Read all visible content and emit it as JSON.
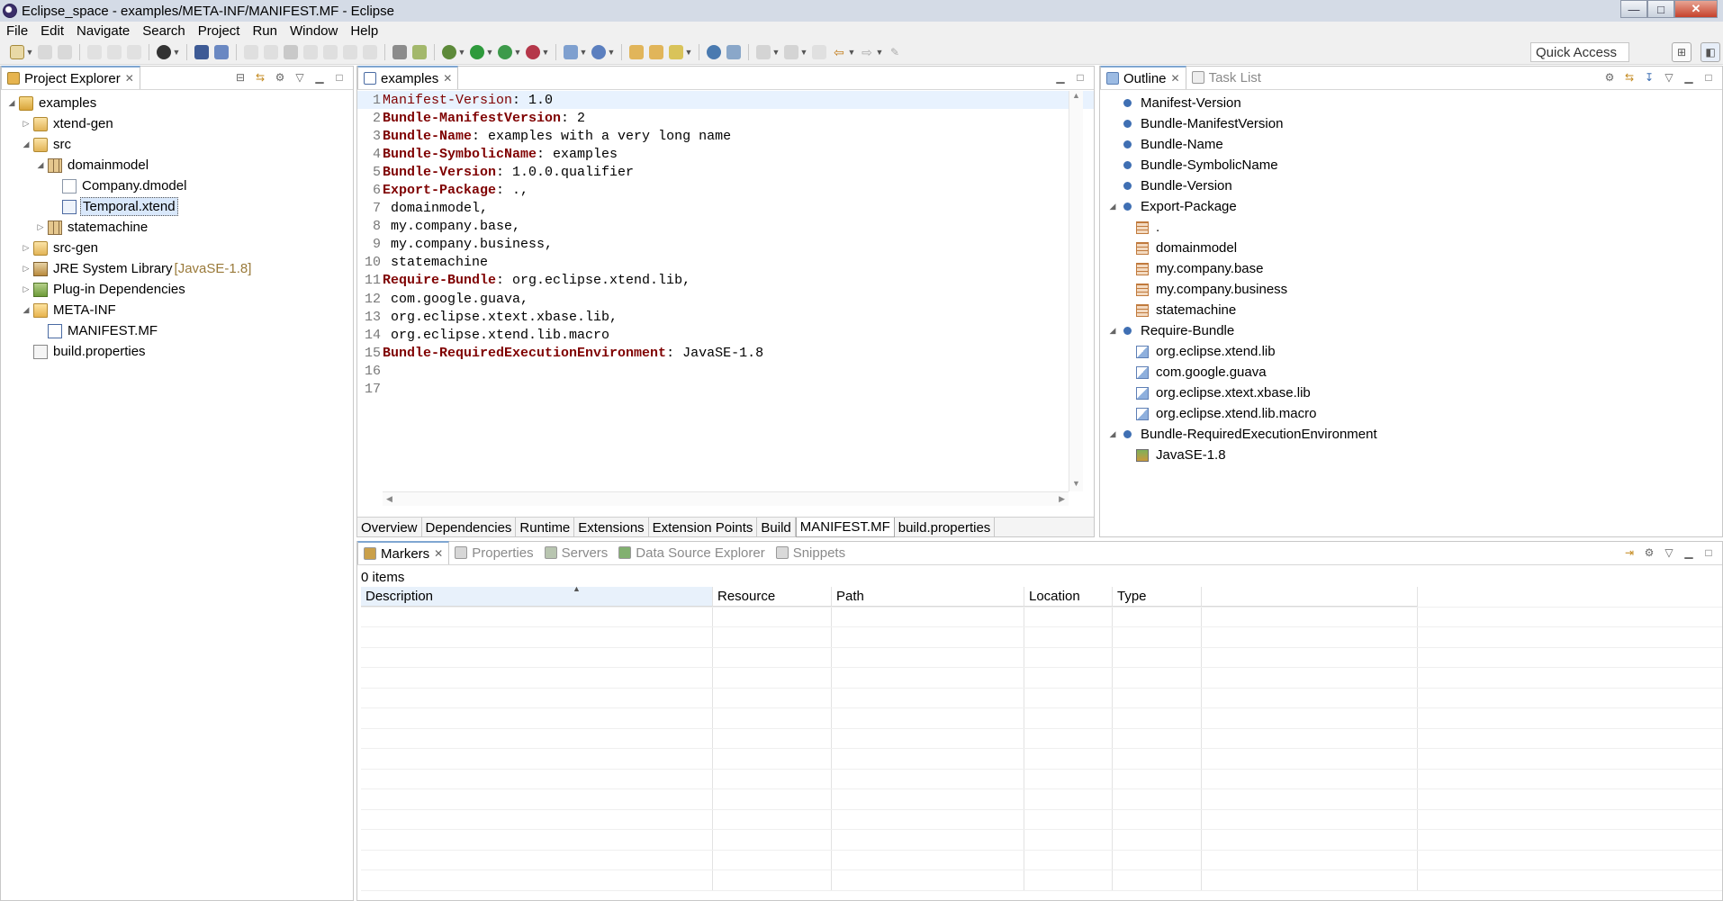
{
  "window": {
    "title": "Eclipse_space - examples/META-INF/MANIFEST.MF - Eclipse",
    "buttons": {
      "minimize": "—",
      "maximize": "□",
      "close": "✕"
    }
  },
  "menu": [
    "File",
    "Edit",
    "Navigate",
    "Search",
    "Project",
    "Run",
    "Window",
    "Help"
  ],
  "toolbar": {
    "quick_access": "Quick Access"
  },
  "project_explorer": {
    "tab_label": "Project Explorer",
    "tree": [
      {
        "label": "examples",
        "icon": "project-icon",
        "twisty": "expanded",
        "level": 0
      },
      {
        "label": "xtend-gen",
        "icon": "source-folder-icon",
        "twisty": "collapsed",
        "level": 1
      },
      {
        "label": "src",
        "icon": "source-folder-icon",
        "twisty": "expanded",
        "level": 1
      },
      {
        "label": "domainmodel",
        "icon": "package-icon",
        "twisty": "expanded",
        "level": 2
      },
      {
        "label": "Company.dmodel",
        "icon": "file-icon",
        "twisty": "none",
        "level": 3
      },
      {
        "label": "Temporal.xtend",
        "icon": "xtend-file-icon",
        "twisty": "none",
        "level": 3,
        "selected": true
      },
      {
        "label": "statemachine",
        "icon": "package-icon",
        "twisty": "collapsed",
        "level": 2
      },
      {
        "label": "src-gen",
        "icon": "source-folder-icon",
        "twisty": "collapsed",
        "level": 1
      },
      {
        "label": "JRE System Library",
        "decoration": "[JavaSE-1.8]",
        "icon": "library-icon",
        "twisty": "collapsed",
        "level": 1
      },
      {
        "label": "Plug-in Dependencies",
        "icon": "plugin-dependencies-icon",
        "twisty": "collapsed",
        "level": 1
      },
      {
        "label": "META-INF",
        "icon": "folder-icon",
        "twisty": "expanded",
        "level": 1
      },
      {
        "label": "MANIFEST.MF",
        "icon": "manifest-file-icon",
        "twisty": "none",
        "level": 2
      },
      {
        "label": "build.properties",
        "icon": "properties-file-icon",
        "twisty": "none",
        "level": 1
      }
    ]
  },
  "editor": {
    "tab_label": "examples",
    "lines": [
      {
        "n": "1",
        "key": "Manifest-Version",
        "val": ": 1.0"
      },
      {
        "n": "2",
        "key": "Bundle-ManifestVersion",
        "val": ": 2"
      },
      {
        "n": "3",
        "key": "Bundle-Name",
        "val": ": examples with a very long name"
      },
      {
        "n": "4",
        "key": "Bundle-SymbolicName",
        "val": ": examples"
      },
      {
        "n": "5",
        "key": "Bundle-Version",
        "val": ": 1.0.0.qualifier"
      },
      {
        "n": "6",
        "key": "Export-Package",
        "val": ": .,"
      },
      {
        "n": "7",
        "key": "",
        "val": " domainmodel,"
      },
      {
        "n": "8",
        "key": "",
        "val": " my.company.base,"
      },
      {
        "n": "9",
        "key": "",
        "val": " my.company.business,"
      },
      {
        "n": "10",
        "key": "",
        "val": " statemachine"
      },
      {
        "n": "11",
        "key": "Require-Bundle",
        "val": ": org.eclipse.xtend.lib,"
      },
      {
        "n": "12",
        "key": "",
        "val": " com.google.guava,"
      },
      {
        "n": "13",
        "key": "",
        "val": " org.eclipse.xtext.xbase.lib,"
      },
      {
        "n": "14",
        "key": "",
        "val": " org.eclipse.xtend.lib.macro"
      },
      {
        "n": "15",
        "key": "Bundle-RequiredExecutionEnvironment",
        "val": ": JavaSE-1.8"
      },
      {
        "n": "16",
        "key": "",
        "val": ""
      },
      {
        "n": "17",
        "key": "",
        "val": ""
      }
    ],
    "page_tabs": [
      "Overview",
      "Dependencies",
      "Runtime",
      "Extensions",
      "Extension Points",
      "Build",
      "MANIFEST.MF",
      "build.properties"
    ],
    "active_page_tab": "MANIFEST.MF"
  },
  "outline": {
    "tabs": {
      "outline": "Outline",
      "task_list": "Task List"
    },
    "tree": [
      {
        "label": "Manifest-Version",
        "icon": "header-dot",
        "level": 0
      },
      {
        "label": "Bundle-ManifestVersion",
        "icon": "header-dot",
        "level": 0
      },
      {
        "label": "Bundle-Name",
        "icon": "header-dot",
        "level": 0
      },
      {
        "label": "Bundle-SymbolicName",
        "icon": "header-dot",
        "level": 0
      },
      {
        "label": "Bundle-Version",
        "icon": "header-dot",
        "level": 0
      },
      {
        "label": "Export-Package",
        "icon": "header-dot",
        "level": 0,
        "twisty": "expanded"
      },
      {
        "label": ".",
        "icon": "package-icon",
        "level": 1
      },
      {
        "label": "domainmodel",
        "icon": "package-icon",
        "level": 1
      },
      {
        "label": "my.company.base",
        "icon": "package-icon",
        "level": 1
      },
      {
        "label": "my.company.business",
        "icon": "package-icon",
        "level": 1
      },
      {
        "label": "statemachine",
        "icon": "package-icon",
        "level": 1
      },
      {
        "label": "Require-Bundle",
        "icon": "header-dot",
        "level": 0,
        "twisty": "expanded"
      },
      {
        "label": "org.eclipse.xtend.lib",
        "icon": "required-bundle-icon",
        "level": 1
      },
      {
        "label": "com.google.guava",
        "icon": "required-bundle-icon",
        "level": 1
      },
      {
        "label": "org.eclipse.xtext.xbase.lib",
        "icon": "required-bundle-icon",
        "level": 1
      },
      {
        "label": "org.eclipse.xtend.lib.macro",
        "icon": "required-bundle-icon",
        "level": 1
      },
      {
        "label": "Bundle-RequiredExecutionEnvironment",
        "icon": "header-dot",
        "level": 0,
        "twisty": "expanded"
      },
      {
        "label": "JavaSE-1.8",
        "icon": "execution-environment-icon",
        "level": 1
      }
    ]
  },
  "bottom": {
    "tabs": [
      "Markers",
      "Properties",
      "Servers",
      "Data Source Explorer",
      "Snippets"
    ],
    "active_tab": "Markers",
    "item_count": "0 items",
    "columns": [
      "Description",
      "Resource",
      "Path",
      "Location",
      "Type"
    ]
  },
  "colors": {
    "keyword": "#7f0000",
    "selection": "#d9e8fb",
    "active_tab_accent": "#7fa6d1"
  }
}
